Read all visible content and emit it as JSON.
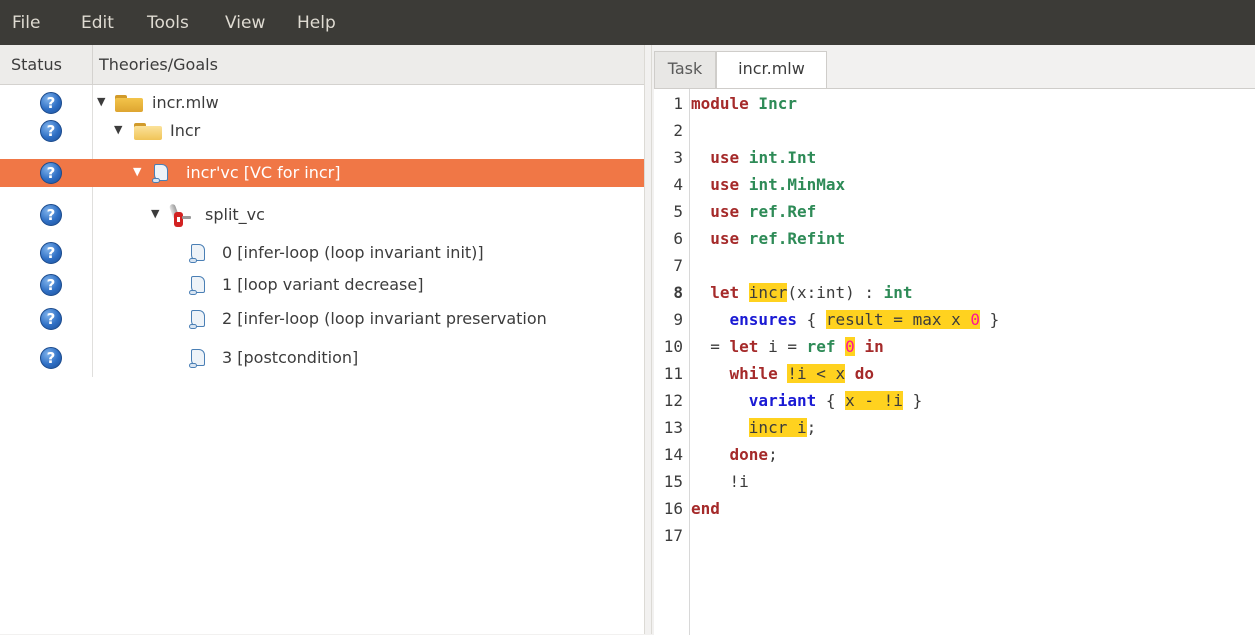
{
  "menu": [
    "File",
    "Edit",
    "Tools",
    "View",
    "Help"
  ],
  "tree_panel": {
    "status_header": "Status",
    "theories_header": "Theories/Goals",
    "rows": [
      {
        "status_icon": "question-icon",
        "expander": "▼",
        "node_icon": "folder-icon",
        "label": "incr.mlw",
        "selected": false
      },
      {
        "status_icon": "question-icon",
        "expander": "▼",
        "node_icon": "open-folder-icon",
        "label": "Incr",
        "selected": false
      },
      {
        "status_icon": "question-icon",
        "expander": "▼",
        "node_icon": "scroll-icon",
        "label": "incr'vc [VC for incr]",
        "selected": true
      },
      {
        "status_icon": "question-icon",
        "expander": "▼",
        "node_icon": "swiss-knife-icon",
        "label": "split_vc",
        "selected": false
      },
      {
        "status_icon": "question-icon",
        "expander": "",
        "node_icon": "scroll-icon",
        "label": "0 [infer-loop (loop invariant init)]",
        "selected": false
      },
      {
        "status_icon": "question-icon",
        "expander": "",
        "node_icon": "scroll-icon",
        "label": "1 [loop variant decrease]",
        "selected": false
      },
      {
        "status_icon": "question-icon",
        "expander": "",
        "node_icon": "scroll-icon",
        "label": "2 [infer-loop (loop invariant preservation",
        "selected": false
      },
      {
        "status_icon": "question-icon",
        "expander": "",
        "node_icon": "scroll-icon",
        "label": "3 [postcondition]",
        "selected": false
      }
    ],
    "status_symbol": "?"
  },
  "tabs": {
    "task": "Task",
    "file": "incr.mlw",
    "active": "incr.mlw"
  },
  "editor": {
    "line_numbers": [
      "1",
      "2",
      "3",
      "4",
      "5",
      "6",
      "7",
      "8",
      "9",
      "10",
      "11",
      "12",
      "13",
      "14",
      "15",
      "16",
      "17"
    ],
    "current_line": "8",
    "lines": {
      "l1a": "module",
      "l1b": " Incr",
      "l3a": "  use",
      "l3b": " int.Int",
      "l4a": "  use",
      "l4b": " int.MinMax",
      "l5a": "  use",
      "l5b": " ref.Ref",
      "l6a": "  use",
      "l6b": " ref.Refint",
      "l8a": "  let ",
      "l8b": "incr",
      "l8c": "(x:int) : ",
      "l8d": "int",
      "l9a": "    ",
      "l9b": "ensures",
      "l9c": " { ",
      "l9d": "result = max x ",
      "l9e": "0",
      "l9f": " }",
      "l10a": "  = ",
      "l10b": "let",
      "l10c": " i = ",
      "l10d": "ref",
      "l10e": " ",
      "l10f": "0",
      "l10g": " ",
      "l10h": "in",
      "l11a": "    ",
      "l11b": "while",
      "l11c": " ",
      "l11d": "!i < x",
      "l11e": " ",
      "l11f": "do",
      "l12a": "      ",
      "l12b": "variant",
      "l12c": " { ",
      "l12d": "x - !i",
      "l12e": " }",
      "l13a": "      ",
      "l13b": "incr i",
      "l13c": ";",
      "l14a": "    ",
      "l14b": "done",
      "l14c": ";",
      "l15a": "    !i",
      "l16a": "end"
    }
  },
  "colors": {
    "menubar": "#3c3b37",
    "selection": "#f07746",
    "highlight": "#ffd21f",
    "keyword": "#a52a2a",
    "module_name": "#2e8b57",
    "spec_keyword": "#1a1ad4",
    "number": "#ff1493"
  }
}
